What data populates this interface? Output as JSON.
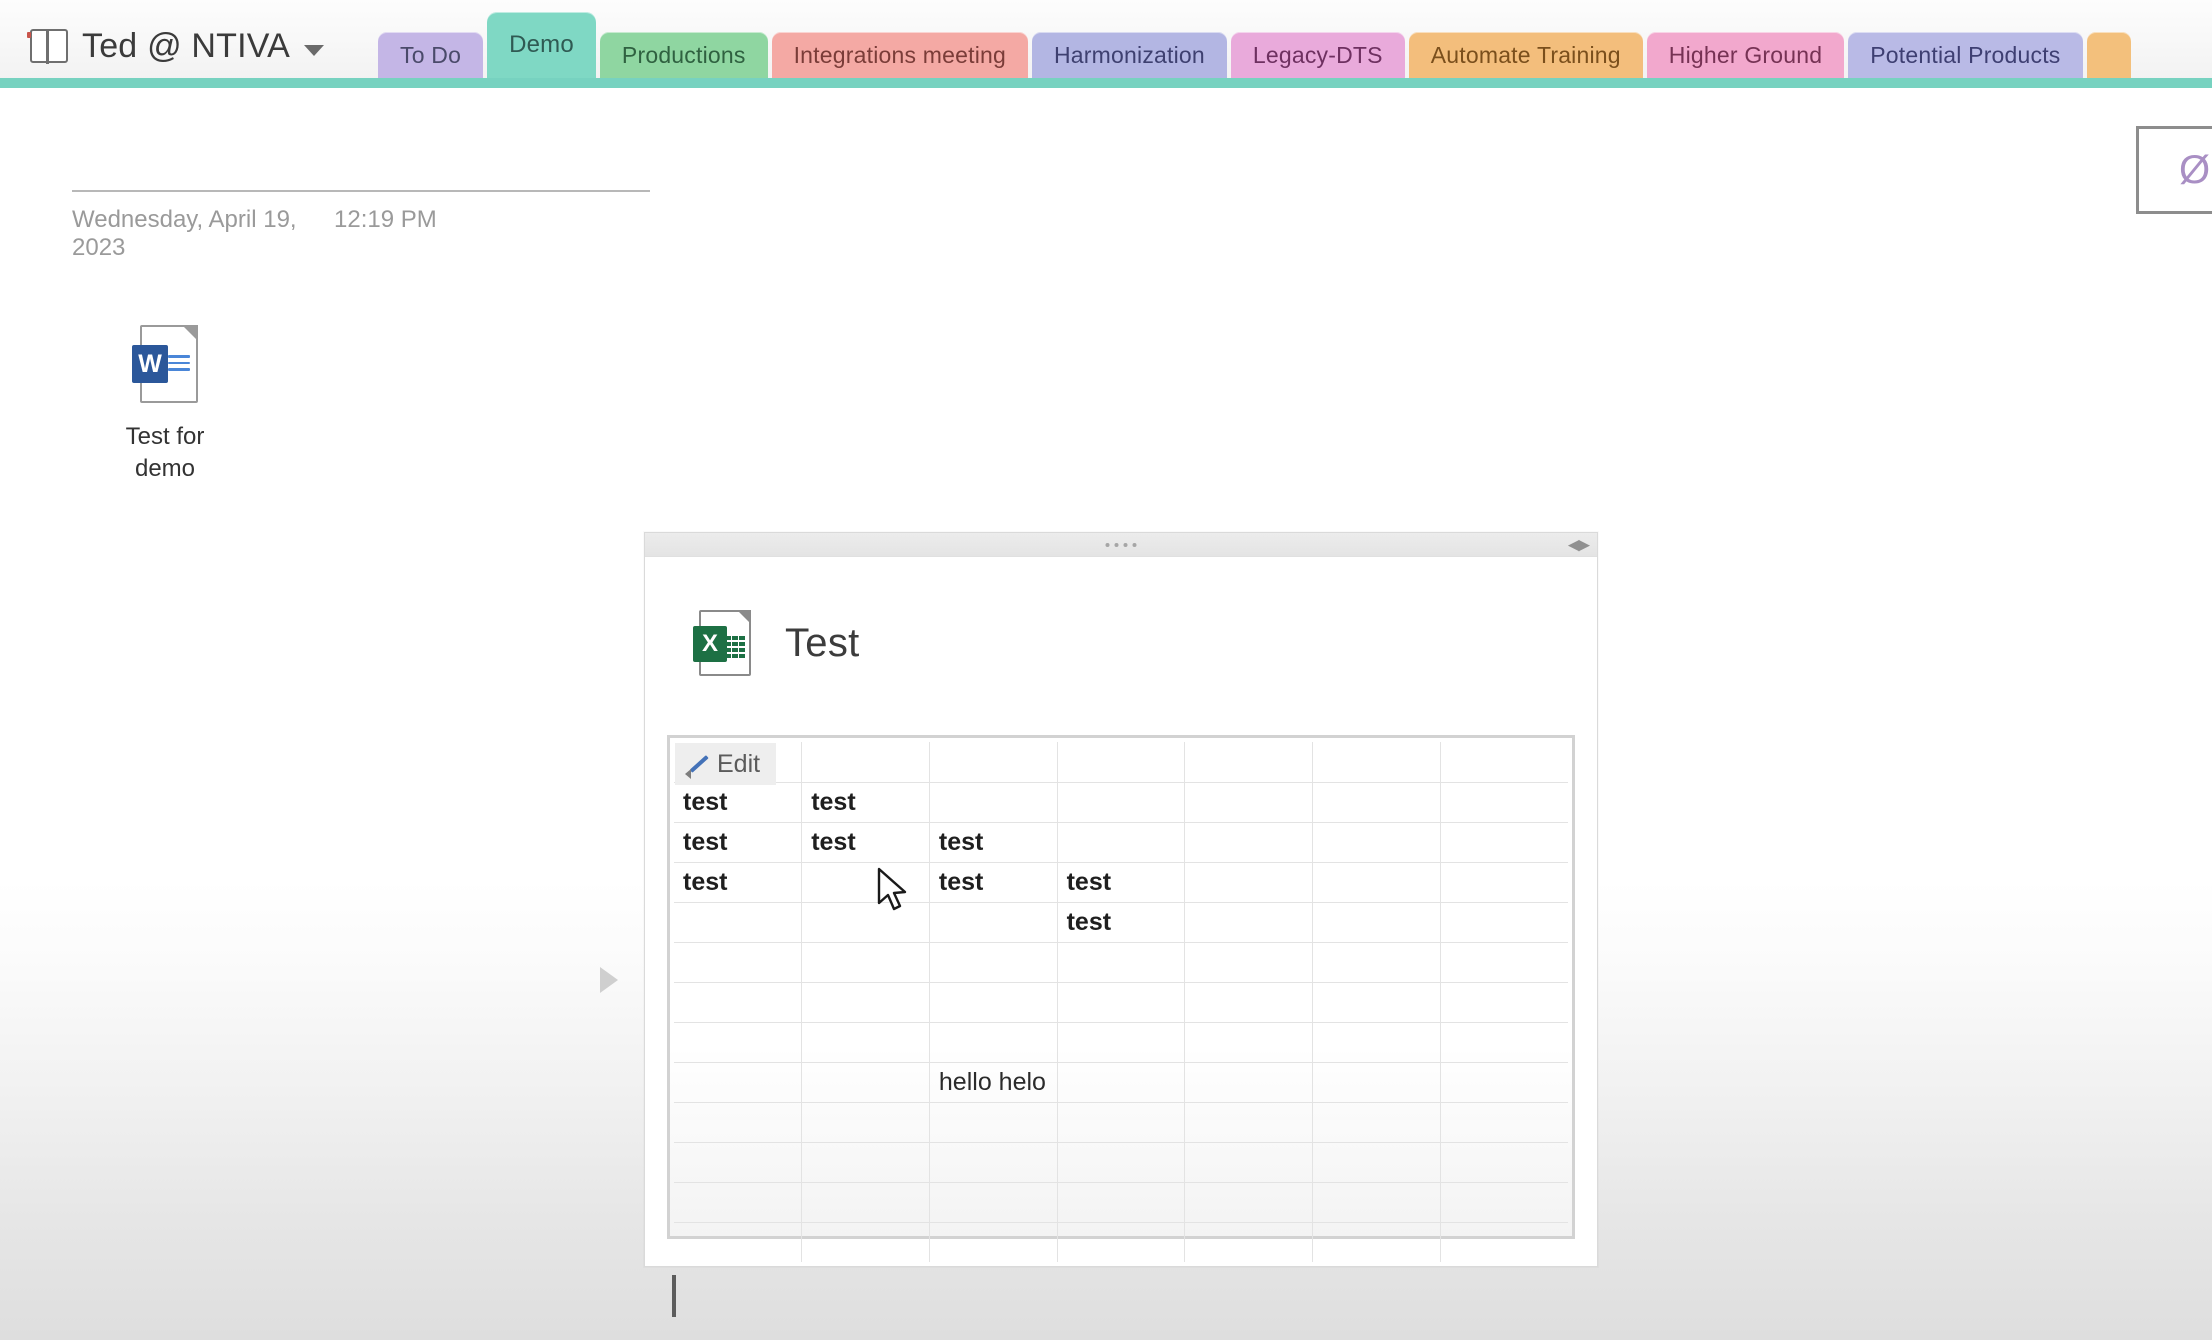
{
  "app": {
    "name": "OneNote",
    "notebook_title": "Ted @ NTIVA",
    "notebook_icon": "notebook-icon",
    "dropdown_icon": "chevron-down-icon"
  },
  "section_tabs": [
    {
      "label": "To Do",
      "color": "#c4b6e6",
      "text_color": "#4a4a6a",
      "active": false
    },
    {
      "label": "Demo",
      "color": "#7fd8c4",
      "text_color": "#2f5a53",
      "active": true
    },
    {
      "label": "Productions",
      "color": "#8fd6a1",
      "text_color": "#2f6140",
      "active": false
    },
    {
      "label": "Integrations meeting",
      "color": "#f4a9a4",
      "text_color": "#7a3c38",
      "active": false
    },
    {
      "label": "Harmonization",
      "color": "#b3b6e3",
      "text_color": "#3e4070",
      "active": false
    },
    {
      "label": "Legacy-DTS",
      "color": "#e9aadb",
      "text_color": "#6e3060",
      "active": false
    },
    {
      "label": "Automate Training",
      "color": "#f3be7c",
      "text_color": "#7a4f1c",
      "active": false
    },
    {
      "label": "Higher Ground",
      "color": "#f2a8cd",
      "text_color": "#763254",
      "active": false
    },
    {
      "label": "Potential Products",
      "color": "#b9bae6",
      "text_color": "#3e3f72",
      "active": false
    },
    {
      "label": "",
      "color": "#f3c07c",
      "text_color": "#7a4f1c",
      "active": false
    }
  ],
  "tab_strip": {
    "underline_color": "#77d2c0"
  },
  "dictate_panel": {
    "icon": "microphone-icon",
    "glyph": "Ø"
  },
  "page": {
    "date": "Wednesday, April 19, 2023",
    "time": "12:19 PM"
  },
  "attachment": {
    "icon": "word-document-icon",
    "badge_letter": "W",
    "filename_line1": "Test for",
    "filename_line2": "demo"
  },
  "embed": {
    "grip_icon": "drag-grip-icon",
    "resize_icon": "resize-horizontal-icon",
    "resize_glyph": "◀▶",
    "file_icon": "excel-document-icon",
    "badge_letter": "X",
    "title": "Test",
    "edit_button": {
      "label": "Edit",
      "icon": "pencil-icon"
    },
    "collapse_marker_icon": "expand-arrow-icon"
  },
  "spreadsheet": {
    "columns": 7,
    "rows": [
      [
        "",
        "",
        "",
        "",
        "",
        "",
        ""
      ],
      [
        "test",
        "test",
        "",
        "",
        "",
        "",
        ""
      ],
      [
        "test",
        "test",
        "test",
        "",
        "",
        "",
        ""
      ],
      [
        "test",
        "",
        "test",
        "test",
        "",
        "",
        ""
      ],
      [
        "",
        "",
        "",
        "test",
        "",
        "",
        ""
      ],
      [
        "",
        "",
        "",
        "",
        "",
        "",
        ""
      ],
      [
        "",
        "",
        "",
        "",
        "",
        "",
        ""
      ],
      [
        "",
        "",
        "",
        "",
        "",
        "",
        ""
      ],
      [
        "",
        "",
        "hello helo",
        "",
        "",
        "",
        ""
      ],
      [
        "",
        "",
        "",
        "",
        "",
        "",
        ""
      ],
      [
        "",
        "",
        "",
        "",
        "",
        "",
        ""
      ],
      [
        "",
        "",
        "",
        "",
        "",
        "",
        ""
      ],
      [
        "",
        "",
        "",
        "",
        "",
        "",
        ""
      ]
    ]
  },
  "cursor": {
    "icon": "mouse-pointer-icon"
  },
  "caret": {
    "icon": "text-caret"
  }
}
